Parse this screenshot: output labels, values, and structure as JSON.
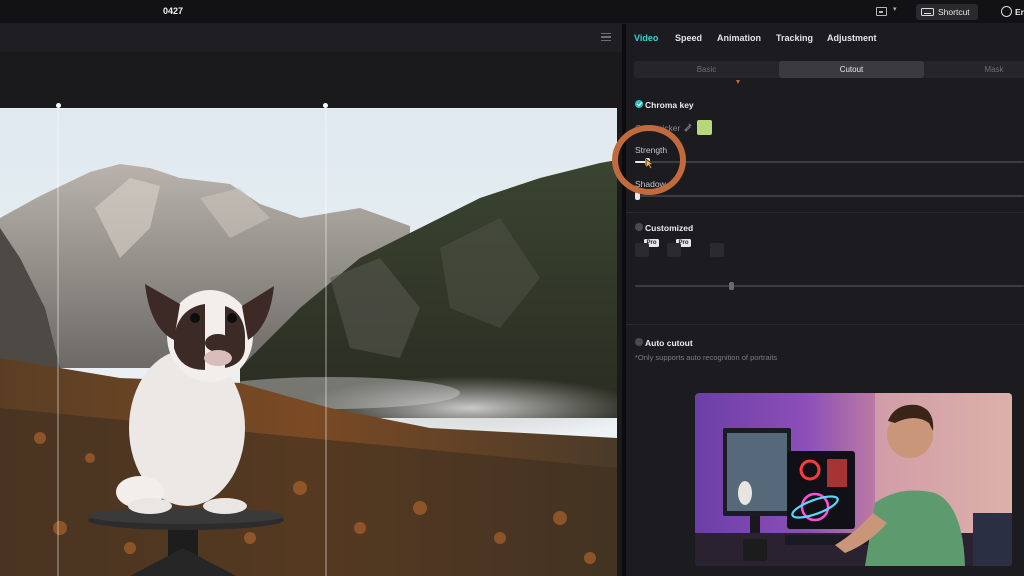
{
  "topbar": {
    "project_title": "0427",
    "layout_chevron": "▾",
    "shortcut_label": "Shortcut",
    "language_label": "En"
  },
  "inspector": {
    "tabs": [
      "Video",
      "Speed",
      "Animation",
      "Tracking",
      "Adjustment"
    ],
    "active_tab": "Video",
    "segments": [
      "Basic",
      "Cutout",
      "Mask"
    ],
    "active_segment": "Cutout",
    "chroma_key": {
      "title": "Chroma key",
      "enabled": true,
      "color_picker_label": "Color picker",
      "picked_color": "#b6d77a",
      "strength_label": "Strength",
      "strength_value": 0.03,
      "shadow_label": "Shadow",
      "shadow_value": 0.0
    },
    "customized": {
      "title": "Customized",
      "enabled": false,
      "pro_badge": "Pro",
      "slider_value": 0.26
    },
    "auto_cutout": {
      "title": "Auto cutout",
      "enabled": false,
      "hint": "*Only supports auto recognition of portraits"
    }
  },
  "colors": {
    "accent": "#3ad0d6",
    "annotation_ring": "#c06a3e",
    "checkbox_on": "#2bbfc6"
  },
  "icons": [
    "layout-icon",
    "keyboard-icon",
    "globe-icon",
    "menu-icon",
    "eyedropper-icon",
    "checkbox-icon",
    "cursor-icon"
  ]
}
